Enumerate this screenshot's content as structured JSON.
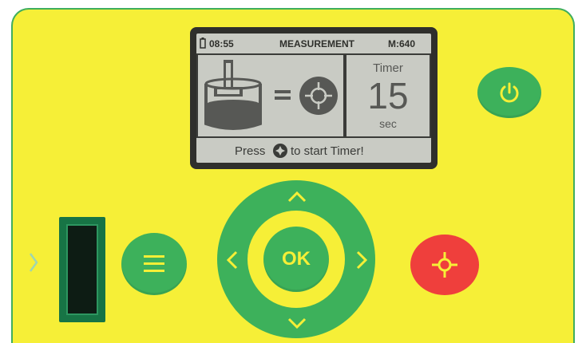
{
  "display": {
    "clock": "08:55",
    "title": "MEASUREMENT",
    "memory": "M:640",
    "timer_label": "Timer",
    "timer_value": "15",
    "timer_unit": "sec",
    "message_prefix": "Press",
    "message_suffix": "to start Timer!"
  },
  "buttons": {
    "ok_label": "OK",
    "power_icon": "power-icon",
    "menu_icon": "menu-icon",
    "measure_icon": "crosshair-icon"
  },
  "colors": {
    "panel": "#f6ef37",
    "green": "#3db15b",
    "red": "#ef3f3c",
    "lcd": "#c9cbc4"
  }
}
